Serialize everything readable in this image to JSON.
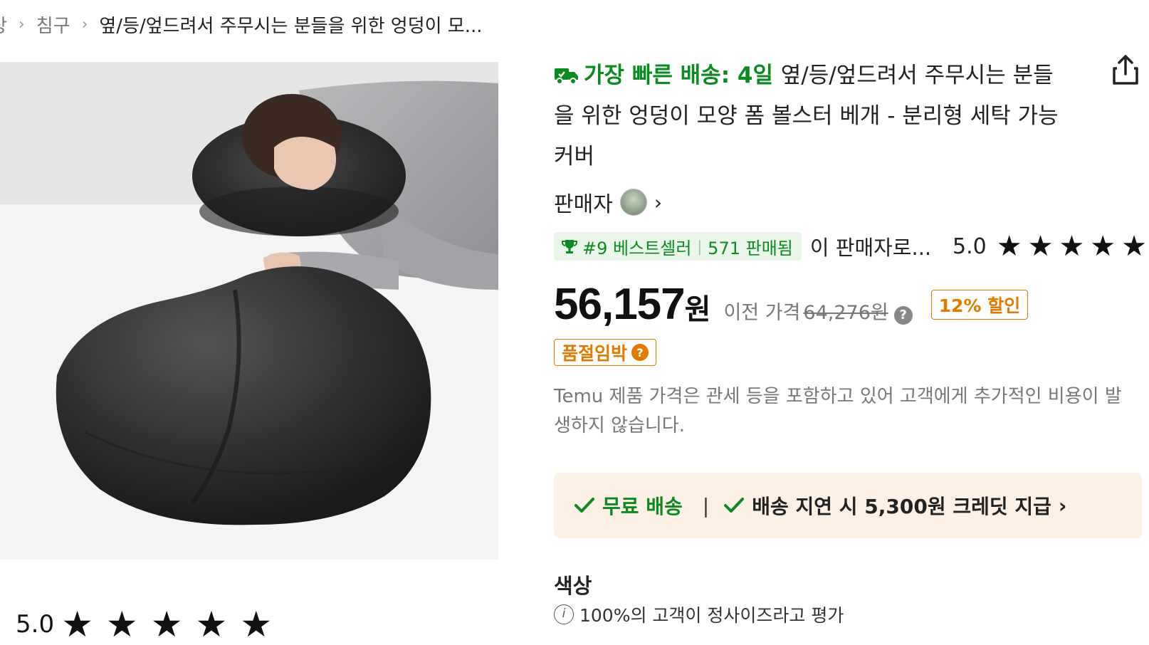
{
  "breadcrumb": {
    "items": [
      "상",
      "침구"
    ],
    "current": "옆/등/엎드려서 주무시는 분들을 위한 엉덩이 모..."
  },
  "product": {
    "image_alt": "엉덩이 모양 폼 볼스터 베개를 베고 자는 여성",
    "fast_shipping": "가장 빠른 배송: 4일",
    "title": "옆/등/엎드려서 주무시는 분들을 위한 엉덩이 모양 폼 볼스터 베개 - 분리형 세탁 가능 커버"
  },
  "seller": {
    "label": "판매자"
  },
  "badge": {
    "bestseller": "#9 베스트셀러",
    "sold": "571 판매됨",
    "seller_text": "이 판매자로...",
    "rating": "5.0",
    "stars": 5
  },
  "price": {
    "current": "56,157",
    "unit": "원",
    "prev_label": "이전 가격",
    "prev_price": "64,276원",
    "discount": "12% 할인",
    "lowstock": "품절임박"
  },
  "notice": "Temu 제품 가격은 관세 등을 포함하고 있어 고객에게 추가적인 비용이 발생하지 않습니다.",
  "shipping": {
    "free": "무료 배송",
    "credit": "배송 지연 시 5,300원 크레딧 지급"
  },
  "options": {
    "color_label": "색상",
    "fit_text": "100%의 고객이 정사이즈라고 평가"
  },
  "bottom_rating": {
    "value": "5.0"
  },
  "colors": {
    "green": "#0a8a1f",
    "orange": "#e07b00",
    "ship_bg": "#fdf0e4"
  }
}
